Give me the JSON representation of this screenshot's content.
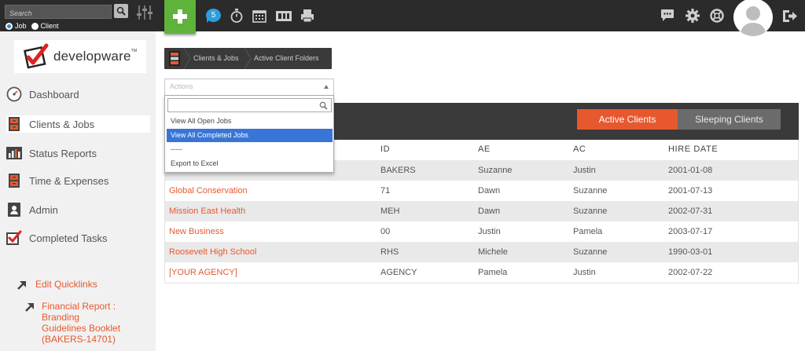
{
  "topbar": {
    "search_placeholder": "Search",
    "radio_job": "Job",
    "radio_client": "Client",
    "notification_count": "5"
  },
  "sidebar": {
    "logo_text": "developware",
    "logo_tm": "TM",
    "items": [
      {
        "label": "Dashboard",
        "icon": "speedometer-icon"
      },
      {
        "label": "Clients & Jobs",
        "icon": "file-cabinet-icon",
        "active": true
      },
      {
        "label": "Status Reports",
        "icon": "bar-chart-icon"
      },
      {
        "label": "Time & Expenses",
        "icon": "file-cabinet-icon"
      },
      {
        "label": "Admin",
        "icon": "id-badge-icon"
      },
      {
        "label": "Completed Tasks",
        "icon": "checkbox-icon"
      }
    ],
    "edit_quicklinks": "Edit Quicklinks",
    "quicklink_1": [
      "Financial Report : Branding",
      "Guidelines Booklet",
      "(BAKERS-14701)"
    ]
  },
  "breadcrumb": {
    "items": [
      "Clients & Jobs",
      "Active Client Folders"
    ]
  },
  "dropdown": {
    "selected": "Actions",
    "options": [
      "View All Open Jobs",
      "View All Completed Jobs",
      "-----",
      "Export to Excel"
    ],
    "highlighted_index": 1
  },
  "tabs": {
    "active": "Active Clients",
    "sleeping": "Sleeping Clients"
  },
  "table": {
    "headers": [
      "ID",
      "AE",
      "AC",
      "HIRE DATE"
    ],
    "rows": [
      {
        "name": "",
        "id": "BAKERS",
        "ae": "Suzanne",
        "ac": "Justin",
        "hire": "2001-01-08"
      },
      {
        "name": "Global Conservation",
        "id": "71",
        "ae": "Dawn",
        "ac": "Suzanne",
        "hire": "2001-07-13"
      },
      {
        "name": "Mission East Health",
        "id": "MEH",
        "ae": "Dawn",
        "ac": "Suzanne",
        "hire": "2002-07-31"
      },
      {
        "name": "New Business",
        "id": "00",
        "ae": "Justin",
        "ac": "Pamela",
        "hire": "2003-07-17"
      },
      {
        "name": "Roosevelt High School",
        "id": "RHS",
        "ae": "Michele",
        "ac": "Suzanne",
        "hire": "1990-03-01"
      },
      {
        "name": "[YOUR AGENCY]",
        "id": "AGENCY",
        "ae": "Pamela",
        "ac": "Justin",
        "hire": "2002-07-22"
      }
    ]
  },
  "colors": {
    "accent": "#e8582e",
    "add_green": "#5fb33a",
    "badge_blue": "#2a9fe0",
    "dark_bar": "#2b2b2b"
  }
}
